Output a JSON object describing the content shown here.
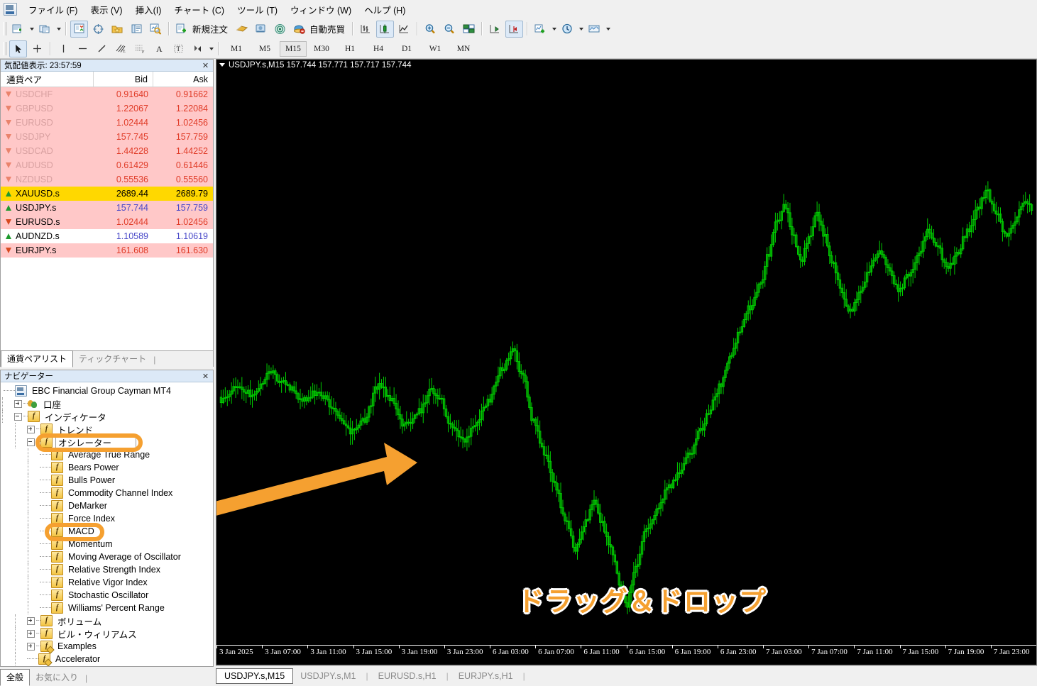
{
  "app": {
    "logo_icon": "mt4-app-icon"
  },
  "menu": {
    "items": [
      {
        "label": "ファイル (F)",
        "name": "menu-file"
      },
      {
        "label": "表示 (V)",
        "name": "menu-view"
      },
      {
        "label": "挿入(I)",
        "name": "menu-insert"
      },
      {
        "label": "チャート (C)",
        "name": "menu-chart"
      },
      {
        "label": "ツール (T)",
        "name": "menu-tools"
      },
      {
        "label": "ウィンドウ (W)",
        "name": "menu-window"
      },
      {
        "label": "ヘルプ (H)",
        "name": "menu-help"
      }
    ]
  },
  "toolbar": {
    "new_order_label": "新規注文",
    "autotrade_label": "自動売買",
    "icons": [
      "new-chart-icon",
      "profiles-icon",
      "market-watch-icon",
      "data-window-icon",
      "navigator-icon",
      "terminal-icon",
      "new-order-icon",
      "metaeditor-icon",
      "expert-advisor-icon",
      "signals-icon",
      "autotrading-icon",
      "bar-chart-icon",
      "candlestick-chart-icon",
      "line-chart-icon",
      "zoom-in-icon",
      "zoom-out-icon",
      "tile-windows-icon",
      "auto-scroll-icon",
      "chart-shift-icon",
      "indicators-icon",
      "periods-icon",
      "templates-icon"
    ]
  },
  "drawing_toolbar": {
    "icons": [
      "cursor-icon",
      "crosshair-icon",
      "vertical-line-icon",
      "horizontal-line-icon",
      "trendline-icon",
      "equidistant-channel-icon",
      "fibonacci-icon",
      "text-icon",
      "text-label-icon",
      "shapes-icon"
    ]
  },
  "periods": {
    "items": [
      "M1",
      "M5",
      "M15",
      "M30",
      "H1",
      "H4",
      "D1",
      "W1",
      "MN"
    ],
    "active": "M15"
  },
  "market_watch": {
    "title": "気配値表示: 23:57:59",
    "close_icon": "close-icon",
    "columns": [
      "通貨ペア",
      "Bid",
      "Ask"
    ],
    "rows": [
      {
        "symbol": "USDCHF",
        "bid": "0.91640",
        "ask": "0.91662",
        "dir": "down",
        "state": "inactive"
      },
      {
        "symbol": "GBPUSD",
        "bid": "1.22067",
        "ask": "1.22084",
        "dir": "down",
        "state": "inactive"
      },
      {
        "symbol": "EURUSD",
        "bid": "1.02444",
        "ask": "1.02456",
        "dir": "down",
        "state": "inactive"
      },
      {
        "symbol": "USDJPY",
        "bid": "157.745",
        "ask": "157.759",
        "dir": "down",
        "state": "inactive"
      },
      {
        "symbol": "USDCAD",
        "bid": "1.44228",
        "ask": "1.44252",
        "dir": "down",
        "state": "inactive"
      },
      {
        "symbol": "AUDUSD",
        "bid": "0.61429",
        "ask": "0.61446",
        "dir": "down",
        "state": "inactive"
      },
      {
        "symbol": "NZDUSD",
        "bid": "0.55536",
        "ask": "0.55560",
        "dir": "down",
        "state": "inactive"
      },
      {
        "symbol": "XAUUSD.s",
        "bid": "2689.44",
        "ask": "2689.79",
        "dir": "up",
        "state": "selected"
      },
      {
        "symbol": "USDJPY.s",
        "bid": "157.744",
        "ask": "157.759",
        "dir": "up",
        "state": "active"
      },
      {
        "symbol": "EURUSD.s",
        "bid": "1.02444",
        "ask": "1.02456",
        "dir": "down",
        "state": "active"
      },
      {
        "symbol": "AUDNZD.s",
        "bid": "1.10589",
        "ask": "1.10619",
        "dir": "up",
        "state": "normal"
      },
      {
        "symbol": "EURJPY.s",
        "bid": "161.608",
        "ask": "161.630",
        "dir": "down",
        "state": "active"
      }
    ],
    "tabs": [
      {
        "label": "通貨ペアリスト",
        "active": true
      },
      {
        "label": "ティックチャート",
        "active": false
      }
    ]
  },
  "navigator": {
    "title": "ナビゲーター",
    "close_icon": "close-icon",
    "tree": [
      {
        "label": "EBC Financial Group Cayman MT4",
        "depth": 0,
        "icon": "terminal-icon",
        "expander": null
      },
      {
        "label": "口座",
        "depth": 1,
        "icon": "accounts-icon",
        "expander": "plus"
      },
      {
        "label": "インディケータ",
        "depth": 1,
        "icon": "indicator-icon",
        "expander": "minus"
      },
      {
        "label": "トレンド",
        "depth": 2,
        "icon": "indicator-icon",
        "expander": "plus"
      },
      {
        "label": "オシレーター",
        "depth": 2,
        "icon": "indicator-icon",
        "expander": "minus",
        "selected": true,
        "highlight": true
      },
      {
        "label": "Average True Range",
        "depth": 3,
        "icon": "indicator-icon",
        "expander": null
      },
      {
        "label": "Bears Power",
        "depth": 3,
        "icon": "indicator-icon",
        "expander": null
      },
      {
        "label": "Bulls Power",
        "depth": 3,
        "icon": "indicator-icon",
        "expander": null
      },
      {
        "label": "Commodity Channel Index",
        "depth": 3,
        "icon": "indicator-icon",
        "expander": null
      },
      {
        "label": "DeMarker",
        "depth": 3,
        "icon": "indicator-icon",
        "expander": null
      },
      {
        "label": "Force Index",
        "depth": 3,
        "icon": "indicator-icon",
        "expander": null
      },
      {
        "label": "MACD",
        "depth": 3,
        "icon": "indicator-icon",
        "expander": null,
        "highlight": true
      },
      {
        "label": "Momentum",
        "depth": 3,
        "icon": "indicator-icon",
        "expander": null
      },
      {
        "label": "Moving Average of Oscillator",
        "depth": 3,
        "icon": "indicator-icon",
        "expander": null
      },
      {
        "label": "Relative Strength Index",
        "depth": 3,
        "icon": "indicator-icon",
        "expander": null
      },
      {
        "label": "Relative Vigor Index",
        "depth": 3,
        "icon": "indicator-icon",
        "expander": null
      },
      {
        "label": "Stochastic Oscillator",
        "depth": 3,
        "icon": "indicator-icon",
        "expander": null
      },
      {
        "label": "Williams' Percent Range",
        "depth": 3,
        "icon": "indicator-icon",
        "expander": null
      },
      {
        "label": "ボリューム",
        "depth": 2,
        "icon": "indicator-icon",
        "expander": "plus"
      },
      {
        "label": "ビル・ウィリアムス",
        "depth": 2,
        "icon": "indicator-icon",
        "expander": "plus"
      },
      {
        "label": "Examples",
        "depth": 2,
        "icon": "custom-indicator-icon",
        "expander": "plus"
      },
      {
        "label": "Accelerator",
        "depth": 2,
        "icon": "custom-indicator-icon",
        "expander": null
      }
    ],
    "tabs": [
      {
        "label": "全般",
        "active": true
      },
      {
        "label": "お気に入り",
        "active": false
      }
    ]
  },
  "chart": {
    "title": "USDJPY.s,M15  157.744 157.771 157.717 157.744",
    "symbol": "USDJPY.s",
    "timeframe": "M15",
    "ohlc": {
      "open": "157.744",
      "high": "157.771",
      "low": "157.717",
      "close": "157.744"
    },
    "bg_color": "#000000",
    "candle_color": "#00CC00",
    "time_labels": [
      "3 Jan 2025",
      "3 Jan 07:00",
      "3 Jan 11:00",
      "3 Jan 15:00",
      "3 Jan 19:00",
      "3 Jan 23:00",
      "6 Jan 03:00",
      "6 Jan 07:00",
      "6 Jan 11:00",
      "6 Jan 15:00",
      "6 Jan 19:00",
      "6 Jan 23:00",
      "7 Jan 03:00",
      "7 Jan 07:00",
      "7 Jan 11:00",
      "7 Jan 15:00",
      "7 Jan 19:00",
      "7 Jan 23:00"
    ],
    "annotation": {
      "text": "ドラッグ＆ドロップ",
      "color": "#F5A030",
      "arrow": "drag-drop-arrow"
    },
    "tabs": [
      {
        "label": "USDJPY.s,M15",
        "active": true
      },
      {
        "label": "USDJPY.s,M1",
        "active": false
      },
      {
        "label": "EURUSD.s,H1",
        "active": false
      },
      {
        "label": "EURJPY.s,H1",
        "active": false
      }
    ]
  },
  "chart_data": {
    "type": "candlestick",
    "title": "USDJPY.s M15",
    "xlabel": "",
    "ylabel": "",
    "note": "15-minute USDJPY candlesticks, 3 Jan 2025 – 7 Jan 2025, hollow green bars on black background"
  },
  "colors": {
    "accent_orange": "#F5A030",
    "chart_green": "#00CC00",
    "chart_bg": "#000000",
    "row_pink": "#FFC8C8",
    "row_yellow": "#FFD800",
    "price_red": "#E03C28",
    "price_blue": "#4848C8"
  }
}
